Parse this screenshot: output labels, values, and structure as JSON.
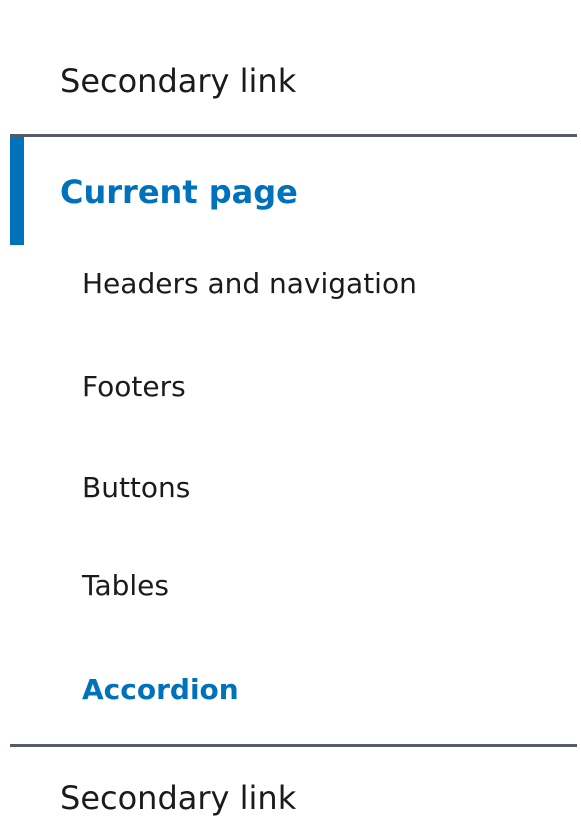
{
  "sidenav": {
    "top_link": "Secondary link",
    "current_page": "Current page",
    "sub_items": [
      "Headers and navigation",
      "Footers",
      "Buttons",
      "Tables",
      "Accordion"
    ],
    "bottom_link": "Secondary link"
  },
  "colors": {
    "accent": "#0071bb",
    "text": "#1b1b1b",
    "divider": "#565c65",
    "background": "#ffffff"
  }
}
